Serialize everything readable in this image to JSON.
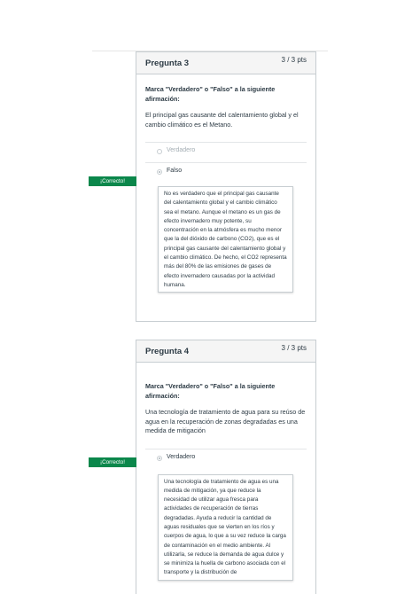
{
  "q3": {
    "title": "Pregunta 3",
    "points": "3 / 3 pts",
    "instruction": "Marca \"Verdadero\" o \"Falso\" a la siguiente afirmación:",
    "statement": "El principal gas causante del calentamiento global y el cambio climático es el Metano.",
    "option_true": "Verdadero",
    "option_false": "Falso",
    "correct_label": "¡Correcto!",
    "feedback": "No es verdadero que el principal gas causante del calentamiento global y el cambio climático sea el metano. Aunque el metano es un gas de efecto invernadero muy potente, su concentración en la atmósfera es mucho menor que la del dióxido de carbono (CO2), que es el principal gas causante del calentamiento global y el cambio climático. De hecho, el CO2 representa más del 80% de las emisiones de gases de efecto invernadero causadas por la actividad humana."
  },
  "q4": {
    "title": "Pregunta 4",
    "points": "3 / 3 pts",
    "instruction": "Marca \"Verdadero\" o \"Falso\" a la siguiente afirmación:",
    "statement": "Una tecnología de tratamiento de agua para su reúso de agua en la recuperación de zonas degradadas es una medida de mitigación",
    "option_true": "Verdadero",
    "correct_label": "¡Correcto!",
    "feedback": "Una tecnología de tratamiento de agua es una medida de mitigación, ya que reduce la necesidad de utilizar agua fresca para actividades de recuperación de tierras degradadas. Ayuda a reducir la cantidad de aguas residuales que se vierten en los ríos y cuerpos de agua, lo que a su vez reduce la carga de contaminación en el medio ambiente. Al utilizarla, se reduce la demanda de agua dulce y se minimiza la huella de carbono asociada con el transporte y la distribución de"
  },
  "colors": {
    "correct": "#0b874b",
    "border": "#c7cdd1",
    "header_bg": "#f5f5f5"
  }
}
